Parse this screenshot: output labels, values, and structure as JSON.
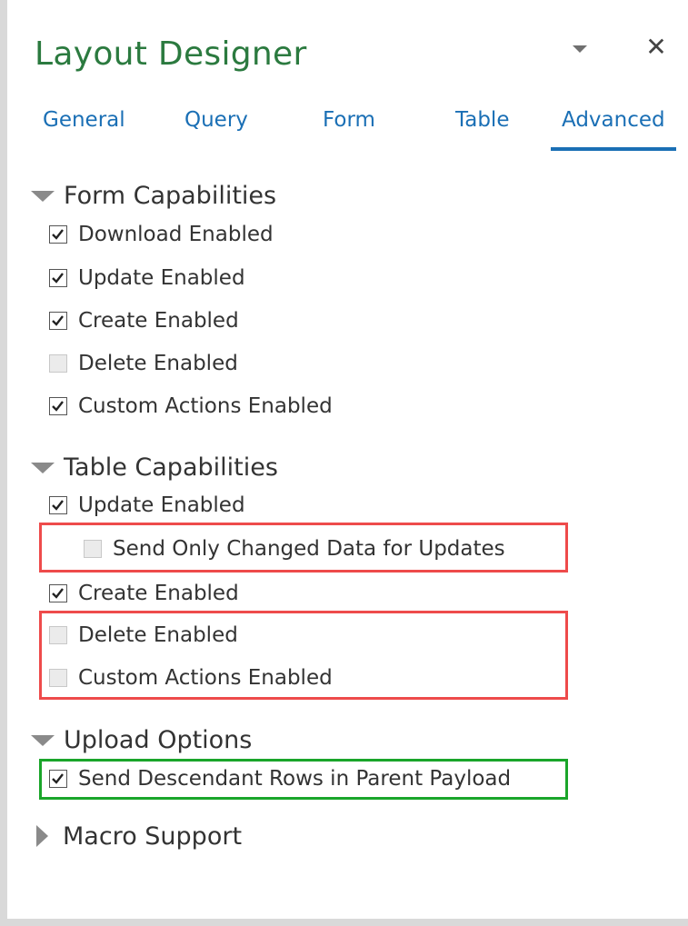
{
  "header": {
    "title": "Layout Designer",
    "dropdown_icon": "chevron-down-icon",
    "close_glyph": "✕"
  },
  "tabs": [
    {
      "label": "General",
      "active": false
    },
    {
      "label": "Query",
      "active": false
    },
    {
      "label": "Form",
      "active": false
    },
    {
      "label": "Table",
      "active": false
    },
    {
      "label": "Advanced",
      "active": true
    }
  ],
  "sections": {
    "form": {
      "title": "Form Capabilities",
      "expanded": true,
      "options": [
        {
          "label": "Download Enabled",
          "checked": true
        },
        {
          "label": "Update Enabled",
          "checked": true
        },
        {
          "label": "Create Enabled",
          "checked": true
        },
        {
          "label": "Delete Enabled",
          "checked": false
        },
        {
          "label": "Custom Actions Enabled",
          "checked": true
        }
      ]
    },
    "table": {
      "title": "Table Capabilities",
      "expanded": true,
      "options": [
        {
          "label": "Update Enabled",
          "checked": true
        },
        {
          "label": "Send Only Changed Data for Updates",
          "checked": false
        },
        {
          "label": "Create Enabled",
          "checked": true
        },
        {
          "label": "Delete Enabled",
          "checked": false
        },
        {
          "label": "Custom Actions Enabled",
          "checked": false
        }
      ]
    },
    "upload": {
      "title": "Upload Options",
      "expanded": true,
      "options": [
        {
          "label": "Send Descendant Rows in Parent Payload",
          "checked": true
        }
      ]
    },
    "macro": {
      "title": "Macro Support",
      "expanded": false
    }
  },
  "colors": {
    "title": "#2b7a3f",
    "tab_text": "#1a6fb5",
    "highlight_red": "#ee4b4b",
    "highlight_green": "#1aa52a"
  }
}
